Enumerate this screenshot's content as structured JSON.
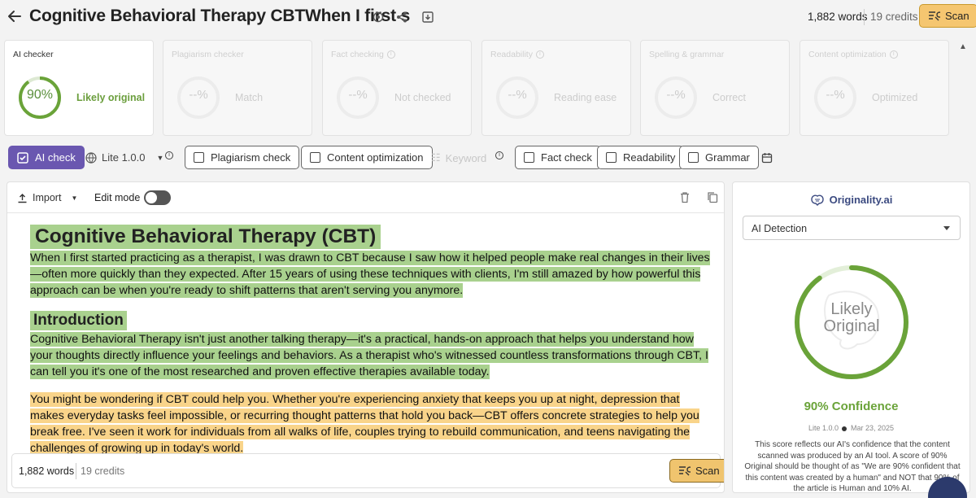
{
  "header": {
    "title": "Cognitive Behavioral Therapy CBTWhen I first s",
    "words": "1,882 words",
    "credits": "19 credits",
    "scan_label": "Scan"
  },
  "cards": [
    {
      "title": "AI checker",
      "pct": "90%",
      "status": "Likely original",
      "active": true
    },
    {
      "title": "Plagiarism checker",
      "pct": "--%",
      "status": "Match",
      "active": false
    },
    {
      "title": "Fact checking",
      "pct": "--%",
      "status": "Not checked",
      "active": false
    },
    {
      "title": "Readability",
      "pct": "--%",
      "status": "Reading ease",
      "active": false
    },
    {
      "title": "Spelling & grammar",
      "pct": "--%",
      "status": "Correct",
      "active": false
    },
    {
      "title": "Content optimization",
      "pct": "--%",
      "status": "Optimized",
      "active": false
    }
  ],
  "toolbar": {
    "ai_check": "AI check",
    "model": "Lite 1.0.0",
    "plagiarism": "Plagiarism check",
    "content_opt": "Content optimization",
    "keyword": "Keyword",
    "fact": "Fact check",
    "readability": "Readability",
    "grammar": "Grammar"
  },
  "editor": {
    "import_label": "Import",
    "edit_mode_label": "Edit mode",
    "heading1": "Cognitive Behavioral Therapy (CBT)",
    "para1": " When I first started practicing as a therapist, I was drawn to CBT because I saw how it helped people make real changes in their lives—often more quickly than they expected.   After 15 years of using these techniques with clients, I'm still amazed by how powerful this approach can be when you're ready to shift patterns that aren't serving you anymore.",
    "heading2": "Introduction",
    "para2": " Cognitive Behavioral Therapy isn't just another talking therapy—it's a practical, hands-on approach that helps you understand how your thoughts directly influence your feelings and behaviors.   As a therapist who's witnessed countless transformations through CBT, I can tell you it's one of the most researched and proven effective therapies available today.",
    "para3": " You might be wondering if CBT could help you.   Whether you're experiencing anxiety that keeps you up at night, depression that makes everyday tasks feel impossible, or recurring thought patterns that hold you back—CBT offers concrete strategies to help you break free.   I've seen it work for individuals from all walks of life, couples trying to rebuild communication, and teens navigating the challenges of growing up in today's world.",
    "footer_words": "1,882 words",
    "footer_credits": "19 credits",
    "footer_scan": "Scan"
  },
  "side": {
    "brand": "Originality.ai",
    "select_value": "AI Detection",
    "ring_line1": "Likely",
    "ring_line2": "Original",
    "ring_fraction": 0.9,
    "confidence": "90% Confidence",
    "meta_version": "Lite 1.0.0",
    "meta_date": "Mar 23, 2025",
    "explanation": "This score reflects our AI's confidence that the content scanned was produced by an AI tool. A score of 90% Original should be thought of as \"We are 90% confident that this content was created by a human\" and NOT that 90% of the article is Human and 10% AI."
  },
  "colors": {
    "accent": "#6a57b0",
    "original_green": "#6aa339",
    "highlight_green": "#a9d18e",
    "highlight_orange": "#f9d48a",
    "scan_gold": "#f5c670"
  },
  "icons": [
    "back-arrow-icon",
    "settings-icon",
    "share-icon",
    "download-icon",
    "scan-icon",
    "scroll-up-icon",
    "checkbox-icon",
    "globe-icon",
    "chevron-down-icon",
    "info-icon",
    "keyword-icon",
    "calendar-icon",
    "upload-icon",
    "trash-icon",
    "copy-icon",
    "brain-icon",
    "chat-icon"
  ]
}
